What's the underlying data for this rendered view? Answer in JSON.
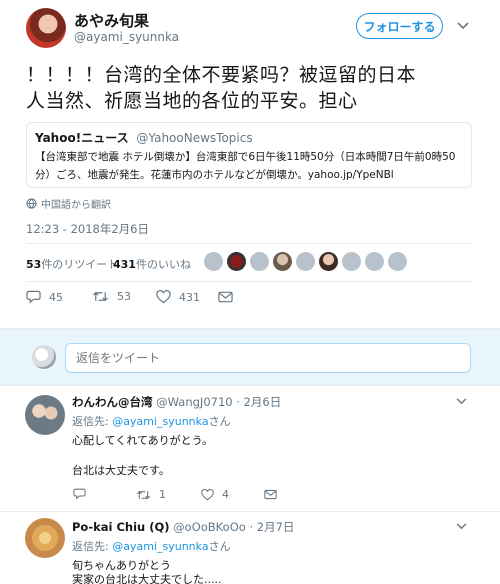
{
  "tweet": {
    "author_name": "あやみ旬果",
    "author_handle": "@ayami_syunnka",
    "follow_label": "フォローする",
    "text_line1": "！！！！台湾的全体不要紧吗？被逗留的日本",
    "text_line2": "人当然、祈愿当地的各位的平安。担心",
    "quote": {
      "source": "Yahoo!ニュース",
      "handle": "@YahooNewsTopics",
      "line1": "【台湾東部で地震 ホテル倒壊か】台湾東部で6日午後11時50分（日本時間7日午前0時50",
      "line2": "分）ごろ、地震が発生。花蓮市内のホテルなどが倒壊か。yahoo.jp/YpeNBl"
    },
    "translate_label": "中国語から翻訳",
    "timestamp": "12:23 - 2018年2月6日",
    "retweet_count": "53",
    "retweet_label": "件のリツイート",
    "like_count": "431",
    "like_label": "件のいいね",
    "action_counts": {
      "reply": "45",
      "retweet": "53",
      "like": "431"
    }
  },
  "reply_box": {
    "placeholder": "返信をツイート"
  },
  "replies": [
    {
      "name": "わんわん@台湾",
      "handle": "@WangJ0710",
      "date": "· 2月6日",
      "reply_to_prefix": "返信先:",
      "reply_to_handle": "@ayami_syunnka",
      "reply_to_suffix": "さん",
      "line1": "心配してくれてありがとう。",
      "line2": "台北は大丈夫です。",
      "counts": {
        "reply": "",
        "retweet": "1",
        "like": "4"
      }
    },
    {
      "name": "Po-kai Chiu (Q)",
      "handle": "@oOoBKoOo",
      "date": "· 2月7日",
      "reply_to_prefix": "返信先:",
      "reply_to_handle": "@ayami_syunnka",
      "reply_to_suffix": "さん",
      "line1": "旬ちゃんありがとう",
      "line2": "実家の台北は大丈夫でした....."
    }
  ],
  "colors": {
    "accent": "#1b95e0",
    "muted": "#657786",
    "divider": "#e6ecf0"
  }
}
